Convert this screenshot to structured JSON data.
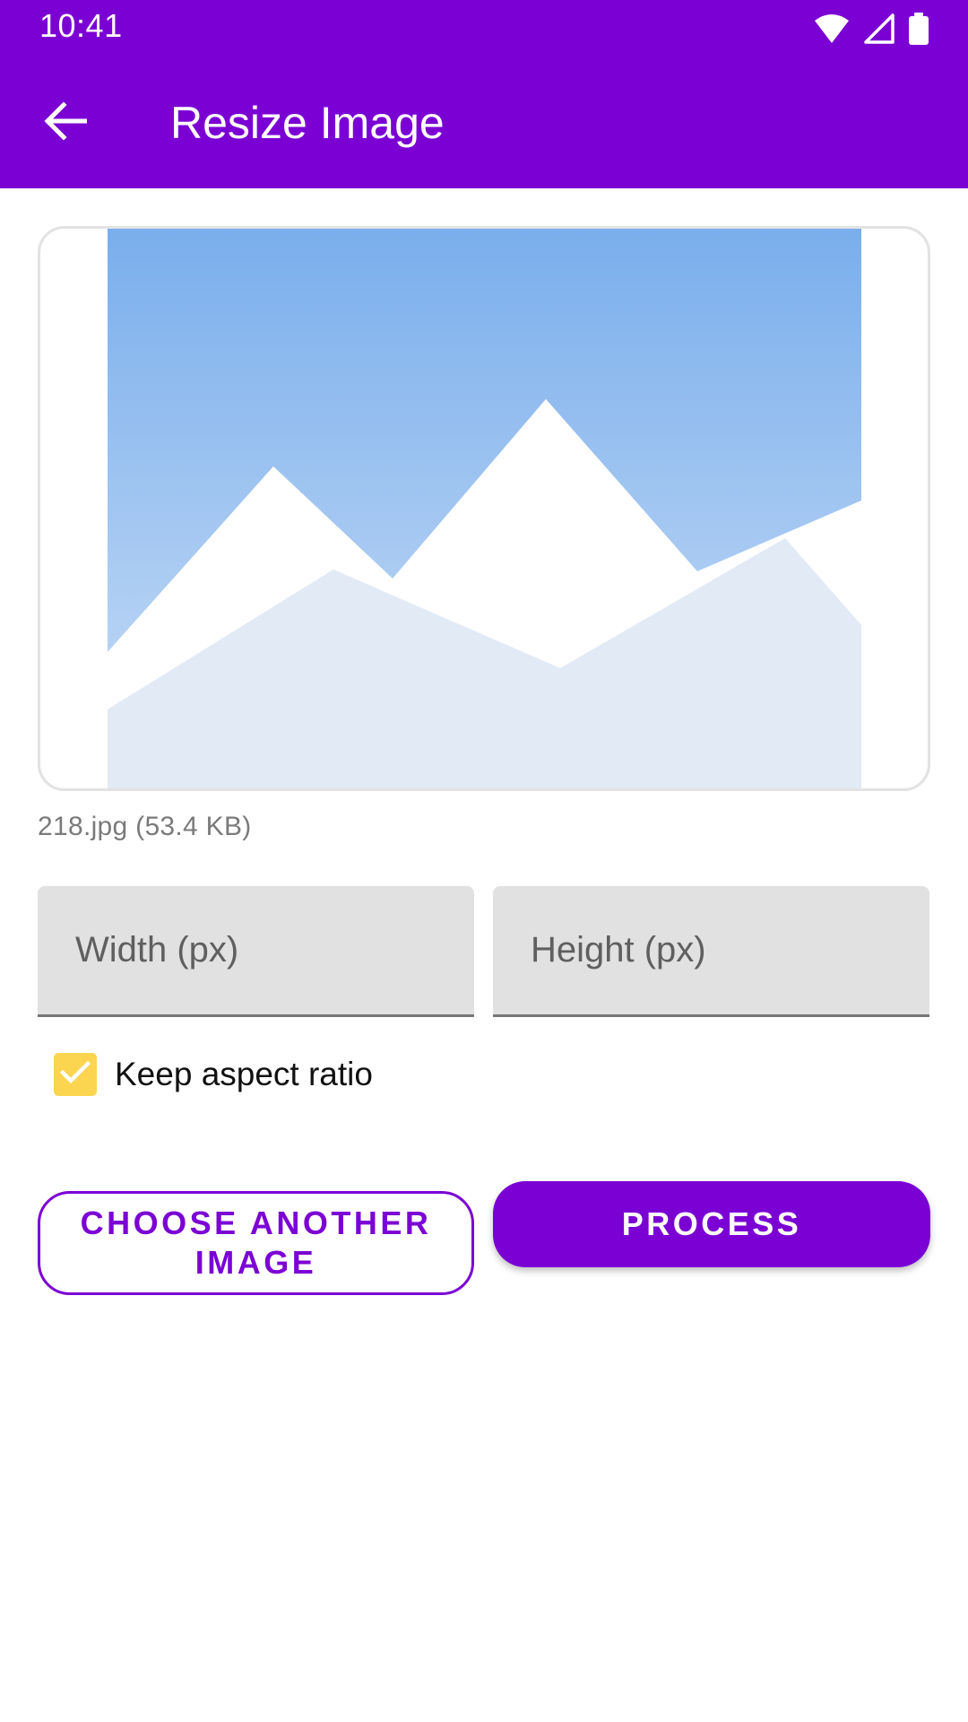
{
  "status_bar": {
    "time": "10:41",
    "icons": [
      "wifi-icon",
      "signal-icon",
      "battery-icon"
    ]
  },
  "app_bar": {
    "title": "Resize Image",
    "back_icon": "arrow-back-icon"
  },
  "preview": {
    "image_icon": "image-placeholder-icon",
    "file_info": "218.jpg (53.4 KB)"
  },
  "inputs": {
    "width_placeholder": "Width (px)",
    "width_value": "",
    "height_placeholder": "Height (px)",
    "height_value": ""
  },
  "options": {
    "keep_aspect_label": "Keep aspect ratio",
    "keep_aspect_checked": true
  },
  "actions": {
    "choose_label": "CHOOSE ANOTHER IMAGE",
    "process_label": "PROCESS"
  },
  "colors": {
    "accent": "#7b00d4",
    "checkbox": "#fcd550",
    "field_bg": "#e1e1e1"
  }
}
